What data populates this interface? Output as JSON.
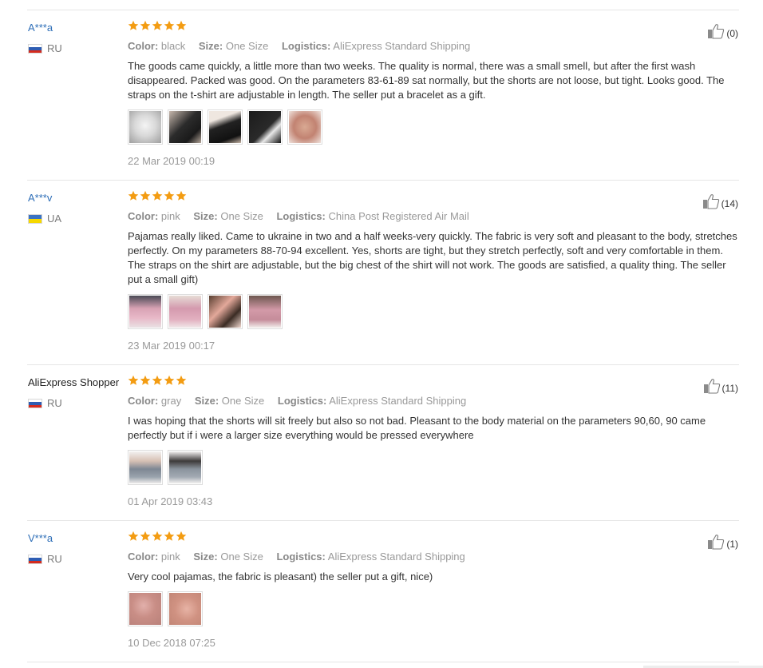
{
  "labels": {
    "color": "Color:",
    "size": "Size:",
    "logistics": "Logistics:"
  },
  "colors": {
    "star": "#f39c12",
    "link": "#2f6fb8",
    "divider": "#e6e6e6",
    "meta": "#999999"
  },
  "reviews": [
    {
      "author": "A***a",
      "country": "RU",
      "rating": 5,
      "helpful": "(0)",
      "color": "black",
      "size": "One Size",
      "logistics": "AliExpress Standard Shipping",
      "text": "The goods came quickly, a little more than two weeks. The quality is normal, there was a small smell, but after the first wash disappeared. Packed was good. On the parameters 83-61-89 sat normally, but the shorts are not loose, but tight. Looks good. The straps on the t-shirt are adjustable in length. The seller put a bracelet as a gift.",
      "photos": [
        "photo-1",
        "photo-2",
        "photo-3",
        "photo-4",
        "photo-5"
      ],
      "date": "22 Mar 2019 00:19"
    },
    {
      "author": "A***v",
      "country": "UA",
      "rating": 5,
      "helpful": "(14)",
      "color": "pink",
      "size": "One Size",
      "logistics": "China Post Registered Air Mail",
      "text": "Pajamas really liked. Came to ukraine in two and a half weeks-very quickly. The fabric is very soft and pleasant to the body, stretches perfectly. On my parameters 88-70-94 excellent. Yes, shorts are tight, but they stretch perfectly, soft and very comfortable in them. The straps on the shirt are adjustable, but the big chest of the shirt will not work. The goods are satisfied, a quality thing. The seller put a small gift)",
      "photos": [
        "photo-1",
        "photo-2",
        "photo-3",
        "photo-4"
      ],
      "date": "23 Mar 2019 00:17"
    },
    {
      "author": "AliExpress Shopper",
      "country": "RU",
      "rating": 5,
      "helpful": "(11)",
      "color": "gray",
      "size": "One Size",
      "logistics": "AliExpress Standard Shipping",
      "text": "I was hoping that the shorts will sit freely but also so not bad. Pleasant to the body material on the parameters 90,60, 90 came perfectly but if i were a larger size everything would be pressed everywhere",
      "photos": [
        "photo-1",
        "photo-2"
      ],
      "date": "01 Apr 2019 03:43"
    },
    {
      "author": "V***a",
      "country": "RU",
      "rating": 5,
      "helpful": "(1)",
      "color": "pink",
      "size": "One Size",
      "logistics": "AliExpress Standard Shipping",
      "text": "Very cool pajamas, the fabric is pleasant) the seller put a gift, nice)",
      "photos": [
        "photo-1",
        "photo-2"
      ],
      "date": "10 Dec 2018 07:25"
    }
  ]
}
